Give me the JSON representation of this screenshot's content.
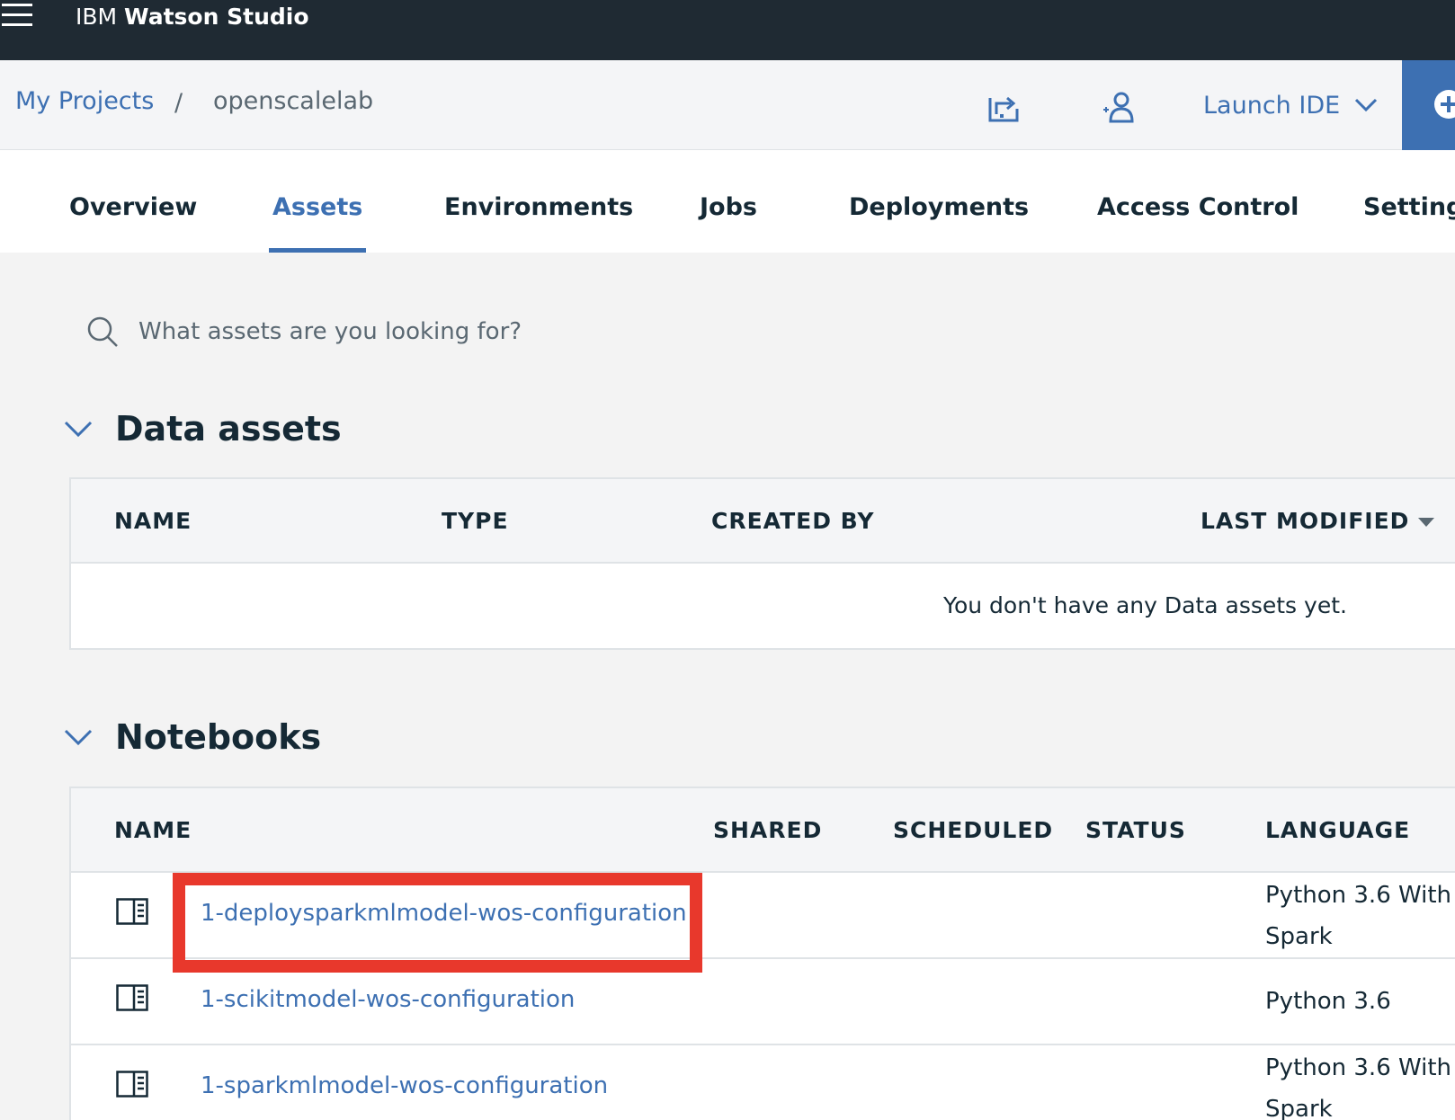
{
  "header": {
    "brand_prefix": "IBM",
    "brand_name": "Watson Studio"
  },
  "breadcrumb": {
    "parent": "My Projects",
    "separator": "/",
    "current": "openscalelab"
  },
  "actions": {
    "launch_ide": "Launch IDE"
  },
  "tabs": [
    {
      "label": "Overview"
    },
    {
      "label": "Assets"
    },
    {
      "label": "Environments"
    },
    {
      "label": "Jobs"
    },
    {
      "label": "Deployments"
    },
    {
      "label": "Access Control"
    },
    {
      "label": "Settings"
    }
  ],
  "active_tab": "Assets",
  "search": {
    "placeholder": "What assets are you looking for?"
  },
  "data_assets": {
    "title": "Data assets",
    "columns": [
      "NAME",
      "TYPE",
      "CREATED BY",
      "LAST MODIFIED"
    ],
    "empty_message": "You don't have any Data assets yet."
  },
  "notebooks": {
    "title": "Notebooks",
    "columns": [
      "NAME",
      "SHARED",
      "SCHEDULED",
      "STATUS",
      "LANGUAGE"
    ],
    "rows": [
      {
        "name": "1-deploysparkmlmodel-wos-configuration",
        "language": "Python 3.6 With Spark"
      },
      {
        "name": "1-scikitmodel-wos-configuration",
        "language": "Python 3.6"
      },
      {
        "name": "1-sparkmlmodel-wos-configuration",
        "language": "Python 3.6 With Spark"
      }
    ]
  },
  "colors": {
    "topbar": "#1f2a33",
    "accent": "#3d70b2",
    "highlight": "#e8382c"
  }
}
